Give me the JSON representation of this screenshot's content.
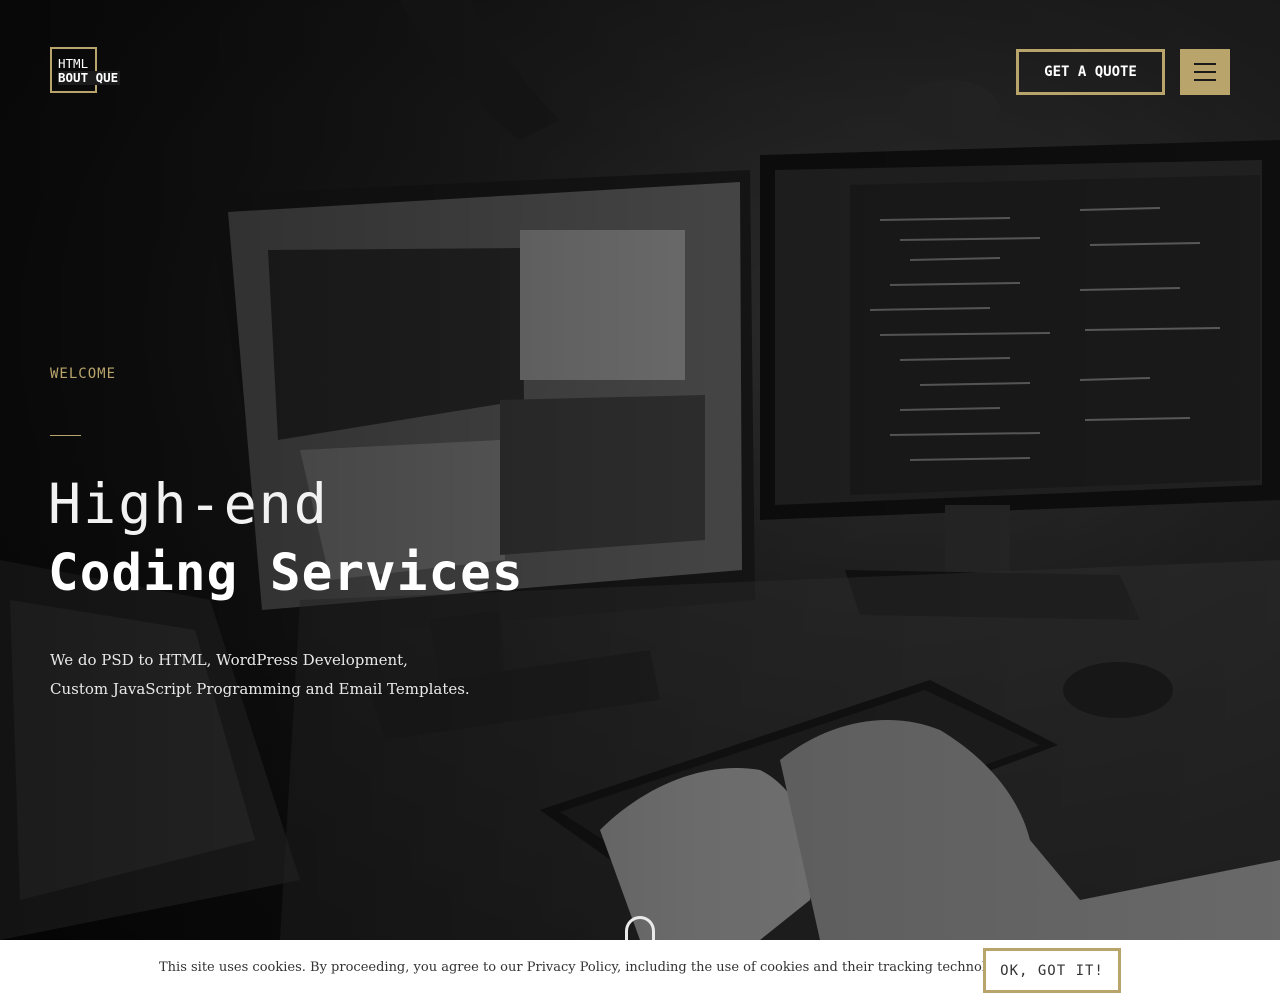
{
  "brand": {
    "logo_line1": "HTML",
    "logo_line2": "BOUT QUE",
    "accent_color": "#b9a46c"
  },
  "header": {
    "quote_label": "GET A QUOTE",
    "menu_icon": "hamburger-menu-icon"
  },
  "hero": {
    "eyebrow": "WELCOME",
    "title_line1": "High-end",
    "title_line2": "Coding Services",
    "intro": "We do PSD to HTML, WordPress Development, Custom JavaScript Programming and Email Templates.",
    "scroll_icon": "scroll-down-icon"
  },
  "cookie": {
    "text": "This site uses cookies. By proceeding, you agree to our Privacy Policy, including the use of cookies and their tracking technologies.",
    "button_label": "OK, GOT IT!"
  }
}
